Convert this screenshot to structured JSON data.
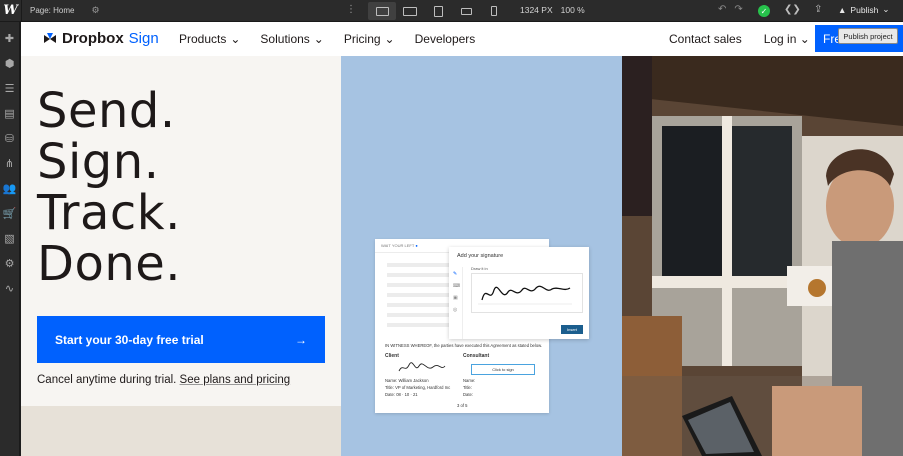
{
  "editor": {
    "logo": "W",
    "page_label": "Page: Home",
    "canvas_width": "1324 PX",
    "zoom": "100 %",
    "publish_label": "Publish",
    "tooltip": "Publish project"
  },
  "site": {
    "brand_main": "Dropbox",
    "brand_sub": "Sign",
    "nav": [
      {
        "label": "Products",
        "has_menu": true
      },
      {
        "label": "Solutions",
        "has_menu": true
      },
      {
        "label": "Pricing",
        "has_menu": true
      },
      {
        "label": "Developers",
        "has_menu": false
      }
    ],
    "contact_label": "Contact sales",
    "login_label": "Log in",
    "cta_top_label": "Fre",
    "headline": [
      "Send.",
      "Sign.",
      "Track.",
      "Done."
    ],
    "trial_button": "Start your 30-day free trial",
    "trial_arrow": "→",
    "cancel_text": "Cancel anytime during trial.",
    "plans_link": "See plans and pricing",
    "doc": {
      "header": "WAIT YOUR LEFT",
      "witness": "IN WITNESS WHEREOF, the parties have executed this Agreement as stated below.",
      "client_label": "Client",
      "consultant_label": "Consultant",
      "name_label": "Name:",
      "name_value": "William Jackson",
      "title_label": "Title:",
      "title_value": "VP of Marketing, Hardford Inc",
      "date_label": "Date:",
      "date_value": "08 · 10 · 21",
      "click_to_sign": "Click to sign",
      "page_count": "3 of 5"
    },
    "sig_panel": {
      "title": "Add your signature",
      "draw_label": "Draw it in",
      "insert_label": "Insert"
    }
  },
  "colors": {
    "brand_blue": "#0061fe",
    "mid_panel": "#a6c3e2",
    "editor_bar": "#2b2b2b",
    "status_green": "#27c24c"
  }
}
